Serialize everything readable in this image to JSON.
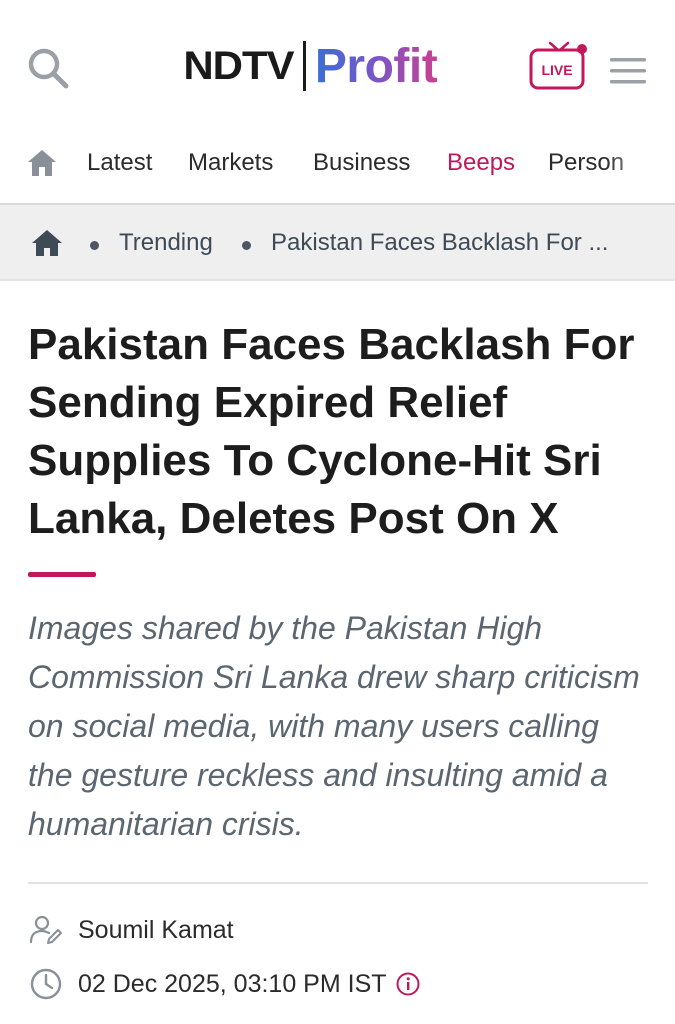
{
  "header": {
    "logo_ndtv": "NDTV",
    "logo_profit": "Profit",
    "live_label": "LIVE",
    "search_icon": "search-icon",
    "menu_icon": "hamburger-menu-icon"
  },
  "nav": {
    "items": [
      {
        "label": "Latest",
        "active": false
      },
      {
        "label": "Markets",
        "active": false
      },
      {
        "label": "Business",
        "active": false
      },
      {
        "label": "Beeps",
        "active": true
      },
      {
        "label": "Person",
        "active": false
      }
    ]
  },
  "breadcrumb": {
    "items": [
      "Trending",
      "Pakistan Faces Backlash For ..."
    ]
  },
  "article": {
    "headline": "Pakistan Faces Backlash For Sending Expired Relief Supplies To Cyclone-Hit Sri Lanka, Deletes Post On X",
    "summary": "Images shared by the Pakistan High Commission Sri Lanka drew sharp criticism on social media, with many users calling the gesture reckless and insulting amid a humanitarian crisis.",
    "author": "Soumil Kamat",
    "date": "02 Dec 2025, 03:10 PM IST"
  },
  "colors": {
    "accent": "#c2185b",
    "text": "#1d1d1d",
    "muted": "#5c6670",
    "breadcrumb_bg": "#efefef"
  }
}
